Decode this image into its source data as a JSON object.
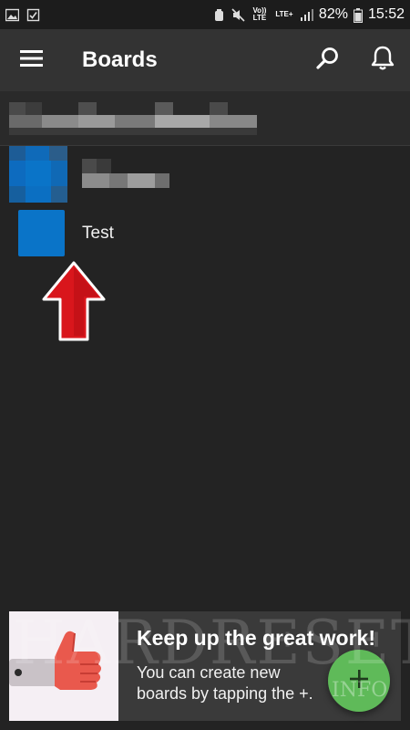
{
  "status_bar": {
    "battery": "82%",
    "time": "15:52",
    "volte_label": "Vo)) LTE",
    "lte_label": "LTE+"
  },
  "app_bar": {
    "title": "Boards"
  },
  "boards": [
    {
      "label": "",
      "color": "#0a74c8"
    },
    {
      "label": "Test",
      "color": "#0a74c8"
    }
  ],
  "banner": {
    "title": "Keep up the great work!",
    "body_line1": "You can create new",
    "body_line2": "boards by tapping the +.",
    "fab_icon": "+"
  },
  "watermark": {
    "main": "HARDRESET",
    "sub": "INFO"
  },
  "colors": {
    "background": "#232323",
    "app_bar": "#333333",
    "board_blue": "#0a74c8",
    "fab_green": "#5fba59",
    "arrow_red": "#d9161c"
  }
}
